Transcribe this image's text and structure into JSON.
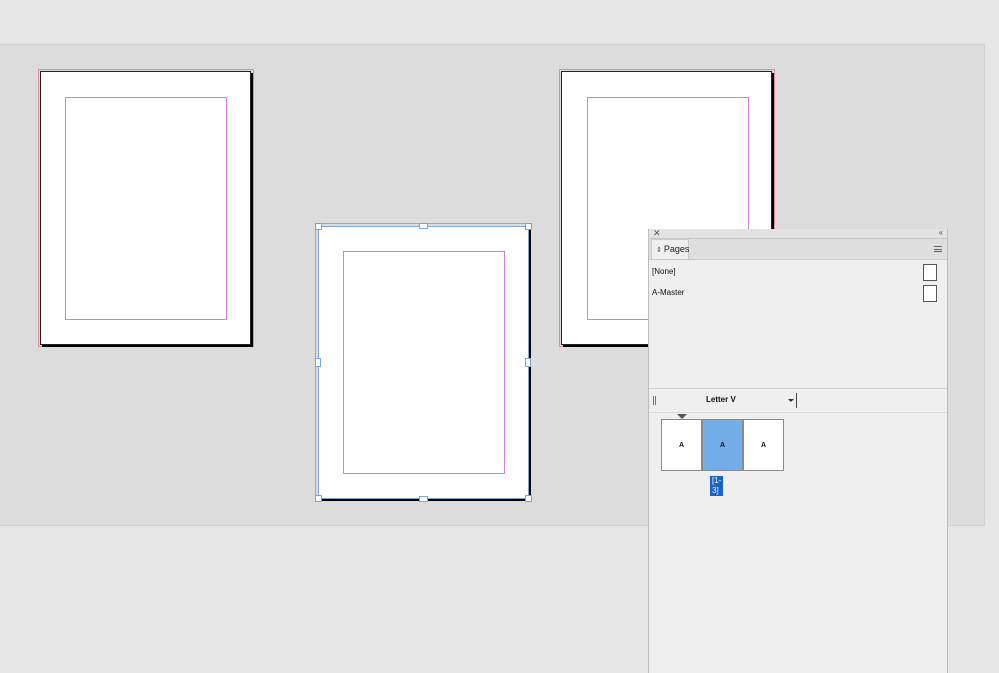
{
  "panel": {
    "title": "Pages",
    "masters": [
      {
        "label": "[None]"
      },
      {
        "label": "A-Master"
      }
    ],
    "page_size": "Letter V",
    "spread": {
      "pages": [
        {
          "label": "A",
          "selected": false
        },
        {
          "label": "A",
          "selected": true
        },
        {
          "label": "A",
          "selected": false
        }
      ],
      "label": "[1-3]"
    }
  },
  "colors": {
    "pasteboard": "#dcdcdc",
    "bleed_guide": "#e58a9b",
    "margin_guide": "#d97ce0",
    "selection": "#7aa6d6",
    "selected_thumb": "#74aee8",
    "spread_label_bg": "#1a62c9"
  },
  "icons": {
    "close": "close-icon",
    "collapse": "double-chevron-icon",
    "tab": "tab-arrows-icon",
    "menu": "hamburger-menu-icon",
    "grip": "grip-icon",
    "dropdown": "caret-down-icon"
  }
}
